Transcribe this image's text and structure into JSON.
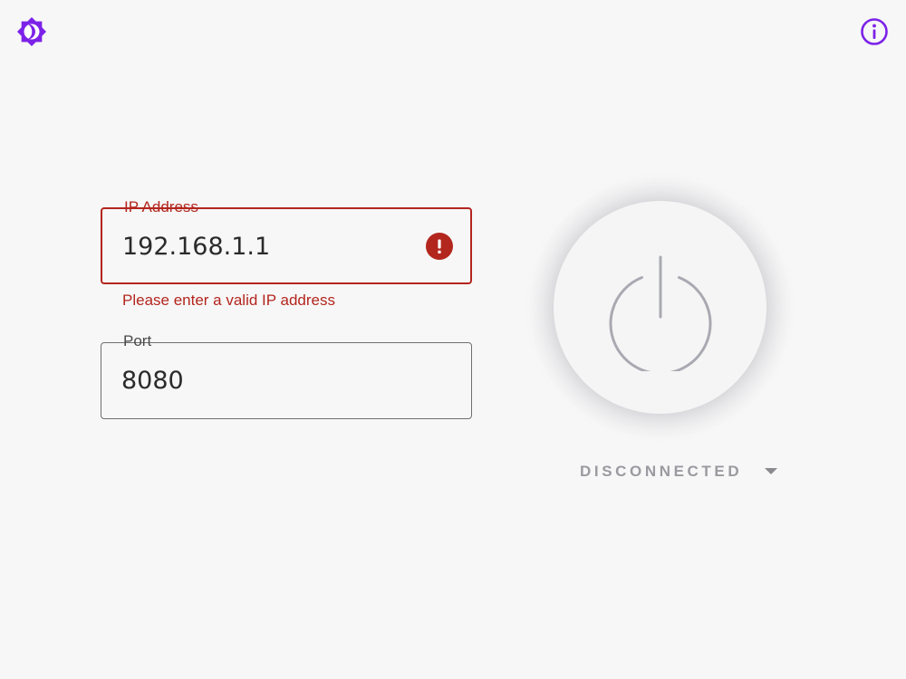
{
  "header": {
    "theme_icon": "brightness-icon",
    "info_icon": "info-icon",
    "accent_color": "#7c22e8"
  },
  "form": {
    "ip": {
      "label": "IP Address",
      "value": "192.168.1.1",
      "error": "Please enter a valid IP address",
      "error_color": "#b3261e"
    },
    "port": {
      "label": "Port",
      "value": "8080"
    }
  },
  "connection": {
    "power_icon": "power-icon",
    "status": "DISCONNECTED",
    "dropdown_icon": "chevron-down-icon"
  }
}
